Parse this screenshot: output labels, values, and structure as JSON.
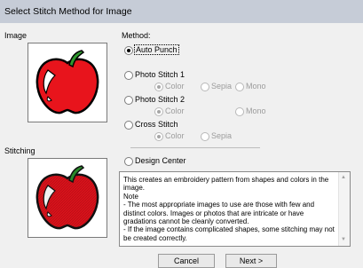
{
  "window": {
    "title": "Select Stitch Method for Image"
  },
  "labels": {
    "image": "Image",
    "method": "Method:",
    "stitching": "Stitching"
  },
  "methods": [
    {
      "label": "Auto Punch",
      "selected": true
    },
    {
      "label": "Photo Stitch 1",
      "selected": false
    },
    {
      "label": "Photo Stitch 2",
      "selected": false
    },
    {
      "label": "Cross Stitch",
      "selected": false
    },
    {
      "label": "Design Center",
      "selected": false
    }
  ],
  "sub_options": {
    "photo1": {
      "color": "Color",
      "sepia": "Sepia",
      "mono": "Mono"
    },
    "photo2": {
      "color": "Color",
      "mono": "Mono"
    },
    "cross": {
      "color": "Color",
      "sepia": "Sepia"
    }
  },
  "description": "This creates an embroidery pattern from shapes and colors in the image.\nNote\n- The most appropriate images to use are those with few and distinct colors. Images or photos that are intricate or have gradations cannot be cleanly converted.\n- If the image contains complicated shapes, some stitching may not be created correctly.",
  "buttons": {
    "cancel": "Cancel",
    "next": "Next >"
  },
  "colors": {
    "apple_red": "#e8141c",
    "stem_green": "#2f9a2f",
    "titlebar": "#c6ccd7"
  }
}
